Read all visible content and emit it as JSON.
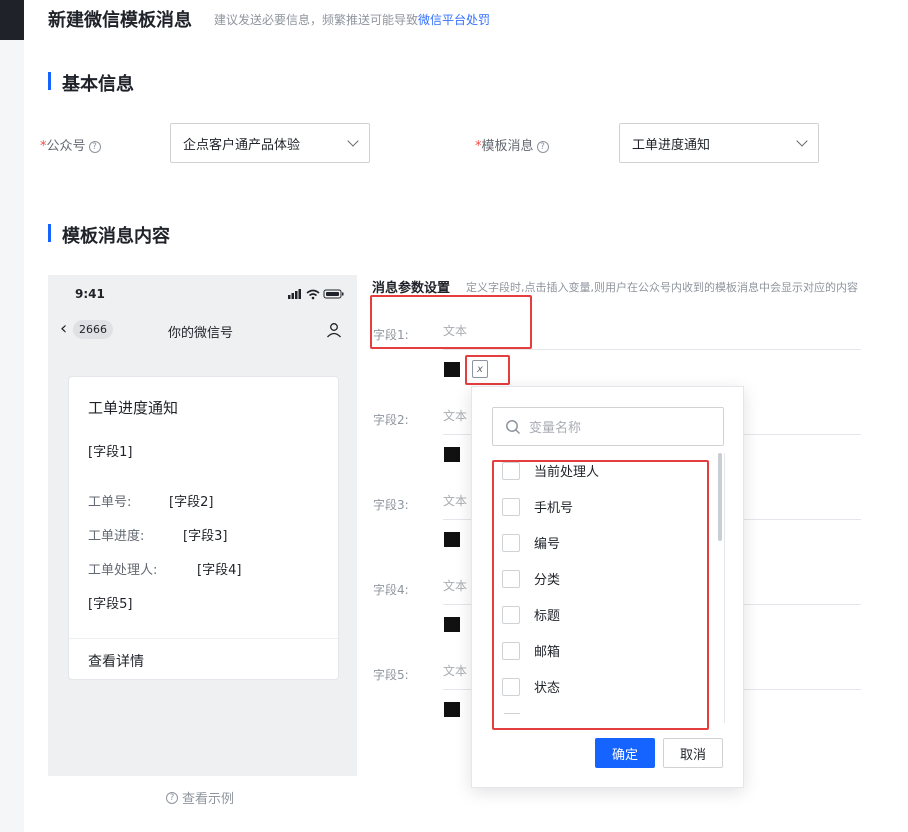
{
  "header": {
    "title": "新建微信模板消息",
    "hint": "建议发送必要信息，频繁推送可能导致",
    "hint_link": "微信平台处罚"
  },
  "basic": {
    "section_title": "基本信息",
    "account_label": "公众号",
    "account_value": "企点客户通产品体验",
    "template_label": "模板消息",
    "template_value": "工单进度通知",
    "required_mark": "*",
    "help_glyph": "?"
  },
  "content_section": {
    "title": "模板消息内容"
  },
  "phone": {
    "time": "9:41",
    "back_count": "2666",
    "account_name": "你的微信号",
    "card_title": "工单进度通知",
    "field1": "[字段1]",
    "rows": [
      {
        "label": "工单号:",
        "value": "[字段2]"
      },
      {
        "label": "工单进度:",
        "value": "[字段3]"
      },
      {
        "label": "工单处理人:",
        "value": "[字段4]"
      }
    ],
    "field5": "[字段5]",
    "detail_link": "查看详情",
    "example_link": "查看示例"
  },
  "params": {
    "title": "消息参数设置",
    "hint": "定义字段时,点击插入变量,则用户在公众号内收到的模板消息中会显示对应的内容",
    "fields": [
      {
        "label": "字段1:",
        "placeholder": "文本"
      },
      {
        "label": "字段2:",
        "placeholder": "文本"
      },
      {
        "label": "字段3:",
        "placeholder": "文本"
      },
      {
        "label": "字段4:",
        "placeholder": "文本"
      },
      {
        "label": "字段5:",
        "placeholder": "文本"
      }
    ]
  },
  "popover": {
    "search_placeholder": "变量名称",
    "options": [
      "当前处理人",
      "手机号",
      "编号",
      "分类",
      "标题",
      "邮箱",
      "状态"
    ],
    "confirm": "确定",
    "cancel": "取消"
  },
  "colors": {
    "accent": "#1664ff",
    "highlight": "#e53e3e"
  }
}
